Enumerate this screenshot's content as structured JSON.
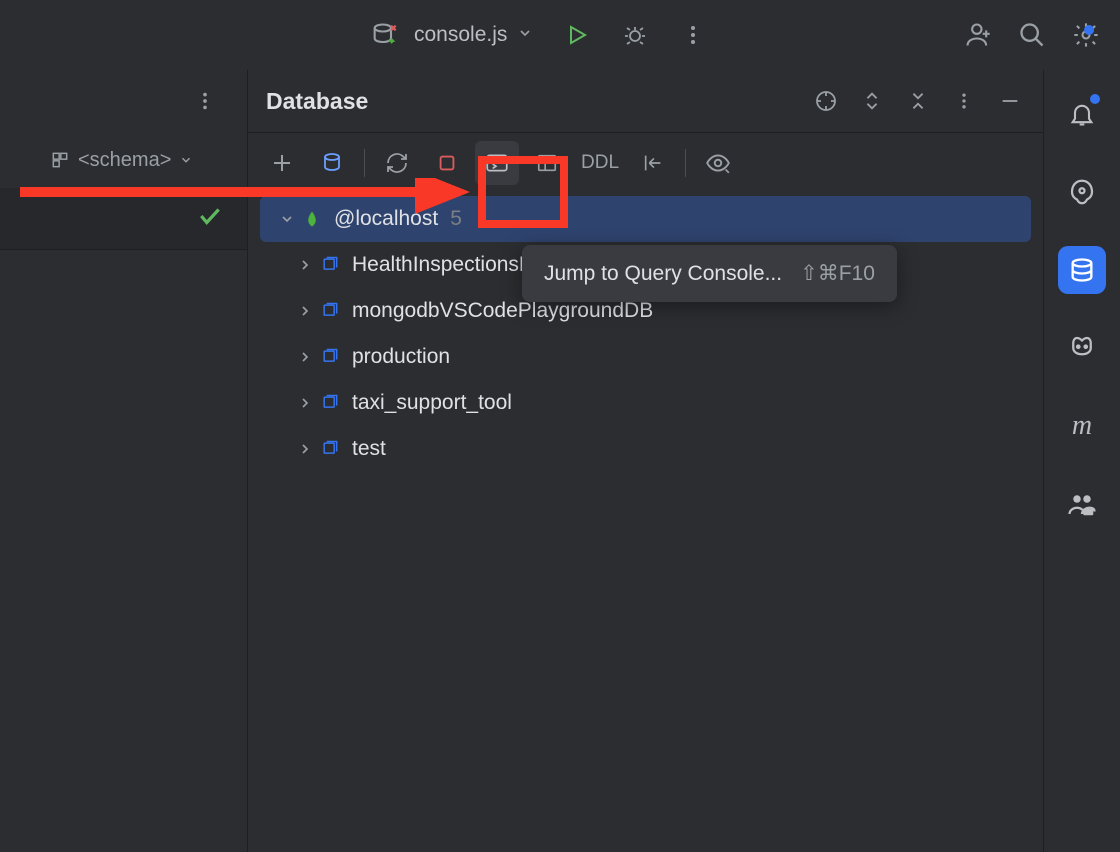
{
  "mainToolbar": {
    "currentFile": "console.js"
  },
  "leftPanel": {
    "schemaLabel": "<schema>"
  },
  "dbPanel": {
    "title": "Database",
    "ddlLabel": "DDL"
  },
  "tree": {
    "root": {
      "label": "@localhost",
      "count": "5"
    },
    "children": [
      {
        "label": "HealthInspectionsDB"
      },
      {
        "label": "mongodbVSCodePlaygroundDB"
      },
      {
        "label": "production"
      },
      {
        "label": "taxi_support_tool"
      },
      {
        "label": "test"
      }
    ]
  },
  "tooltip": {
    "label": "Jump to Query Console...",
    "shortcut": "⇧⌘F10"
  },
  "rightStripe": {
    "meridianLabel": "m"
  },
  "colors": {
    "accent": "#3574f0",
    "annotation": "#f93827",
    "background": "#2b2d30"
  }
}
